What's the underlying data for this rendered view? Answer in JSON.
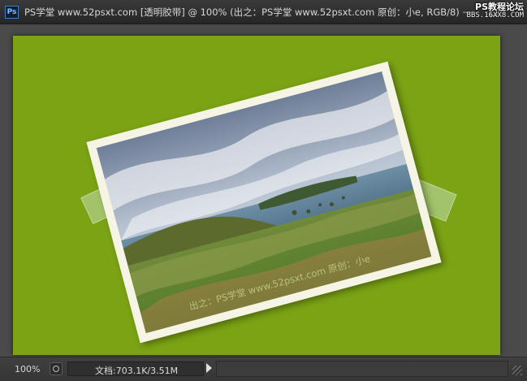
{
  "window": {
    "app_icon_label": "Ps",
    "document_title": "PS学堂 www.52psxt.com [透明胶带] @ 100% (出之：PS学堂 www.52psxt.com   原创：小e, RGB/8)",
    "buttons": [
      "—",
      "□",
      "✕"
    ]
  },
  "overlay": {
    "forum_name": "PS教程论坛",
    "forum_url": "BBS.16XX8.COM"
  },
  "canvas": {
    "background_color": "#7ba314",
    "watermark": "出之：PS学堂 www.52psxt.com   原创：小e"
  },
  "status": {
    "zoom": "100%",
    "doc_size": "文档:703.1K/3.51M"
  }
}
